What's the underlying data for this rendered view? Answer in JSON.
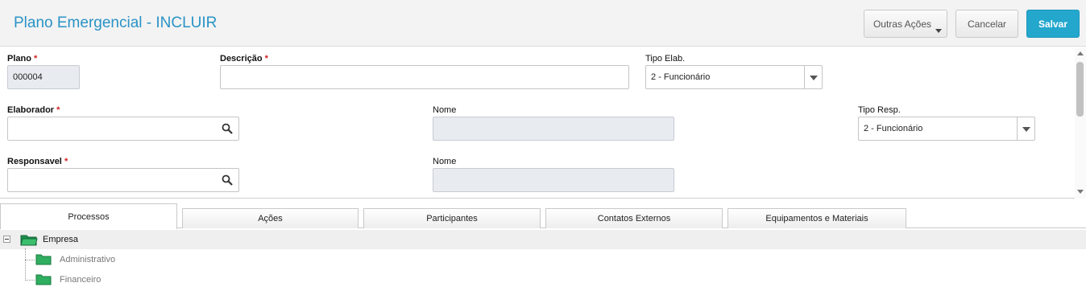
{
  "header": {
    "title": "Plano Emergencial - INCLUIR",
    "buttons": {
      "outras": "Outras Ações",
      "cancelar": "Cancelar",
      "salvar": "Salvar"
    }
  },
  "form": {
    "plano": {
      "label": "Plano",
      "required": "*",
      "value": "000004"
    },
    "descricao": {
      "label": "Descrição",
      "required": "*",
      "value": ""
    },
    "tipo_elab": {
      "label": "Tipo Elab.",
      "value": "2 - Funcionário"
    },
    "elaborador": {
      "label": "Elaborador",
      "required": "*",
      "value": ""
    },
    "nome1": {
      "label": "Nome",
      "value": ""
    },
    "tipo_resp": {
      "label": "Tipo Resp.",
      "value": "2 - Funcionário"
    },
    "responsavel": {
      "label": "Responsavel",
      "required": "*",
      "value": ""
    },
    "nome2": {
      "label": "Nome",
      "value": ""
    }
  },
  "tabs": [
    "Processos",
    "Ações",
    "Participantes",
    "Contatos Externos",
    "Equipamentos e Materiais"
  ],
  "tree": {
    "root": "Empresa",
    "children": [
      "Administrativo",
      "Financeiro"
    ]
  },
  "colors": {
    "accent": "#2a93c6",
    "save": "#23a7cd",
    "folder": "#2fae5f",
    "required": "#d21f1f"
  },
  "icons": {
    "search": "search-icon",
    "dropdown": "chevron-down-icon",
    "folder": "folder-icon",
    "collapse": "collapse-icon"
  }
}
